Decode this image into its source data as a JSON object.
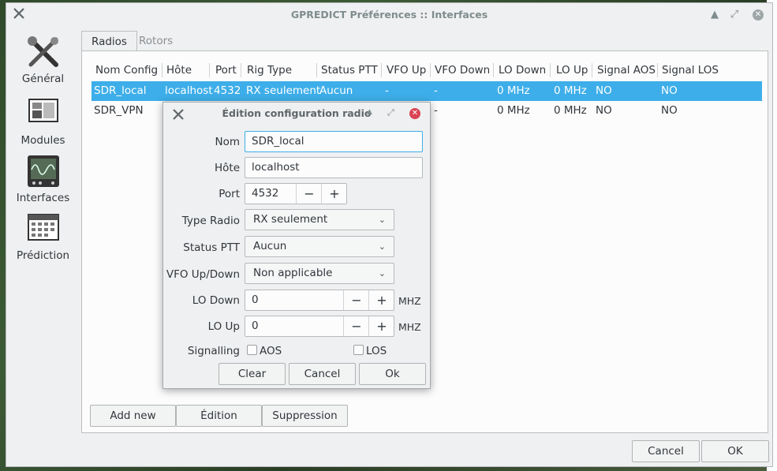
{
  "window": {
    "title": "GPREDICT Préférences :: Interfaces",
    "cancel_label": "Cancel",
    "ok_label": "OK"
  },
  "sidebar": {
    "items": [
      {
        "label": "Général",
        "icon": "tools-icon"
      },
      {
        "label": "Modules",
        "icon": "modules-icon"
      },
      {
        "label": "Interfaces",
        "icon": "oscilloscope-icon"
      },
      {
        "label": "Prédiction",
        "icon": "calendar-icon"
      }
    ]
  },
  "tabs": [
    {
      "label": "Radios",
      "active": true
    },
    {
      "label": "Rotors",
      "active": false
    }
  ],
  "table": {
    "columns": [
      "Nom Config",
      "Hôte",
      "Port",
      "Rig Type",
      "Status PTT",
      "VFO Up",
      "VFO Down",
      "LO Down",
      "LO Up",
      "Signal AOS",
      "Signal LOS"
    ],
    "rows": [
      {
        "name": "SDR_local",
        "host": "localhost",
        "port": "4532",
        "rig_type": "RX seulement",
        "ptt": "Aucun",
        "vfo_up": "-",
        "vfo_down": "-",
        "lo_down": "0 MHz",
        "lo_up": "0 MHz",
        "aos": "NO",
        "los": "NO",
        "selected": true
      },
      {
        "name": "SDR_VPN",
        "host": "",
        "port": "",
        "rig_type": "",
        "ptt": "",
        "vfo_up": "",
        "vfo_down": "-",
        "lo_down": "0 MHz",
        "lo_up": "0 MHz",
        "aos": "NO",
        "los": "NO",
        "selected": false
      }
    ]
  },
  "actions": {
    "add_label": "Add new",
    "edit_label": "Édition",
    "delete_label": "Suppression"
  },
  "dialog": {
    "title": "Édition configuration radio",
    "name_label": "Nom",
    "name_value": "SDR_local",
    "host_label": "Hôte",
    "host_value": "localhost",
    "port_label": "Port",
    "port_value": "4532",
    "radio_type_label": "Type Radio",
    "radio_type_value": "RX seulement",
    "ptt_label": "Status PTT",
    "ptt_value": "Aucun",
    "vfo_label": "VFO Up/Down",
    "vfo_value": "Non applicable",
    "lo_down_label": "LO Down",
    "lo_down_value": "0",
    "lo_up_label": "LO Up",
    "lo_up_value": "0",
    "unit": "MHZ",
    "signalling_label": "Signalling",
    "aos_label": "AOS",
    "los_label": "LOS",
    "clear_label": "Clear",
    "cancel_label": "Cancel",
    "ok_label": "Ok"
  },
  "colors": {
    "selection": "#3daee9",
    "close_red": "#da4453"
  }
}
